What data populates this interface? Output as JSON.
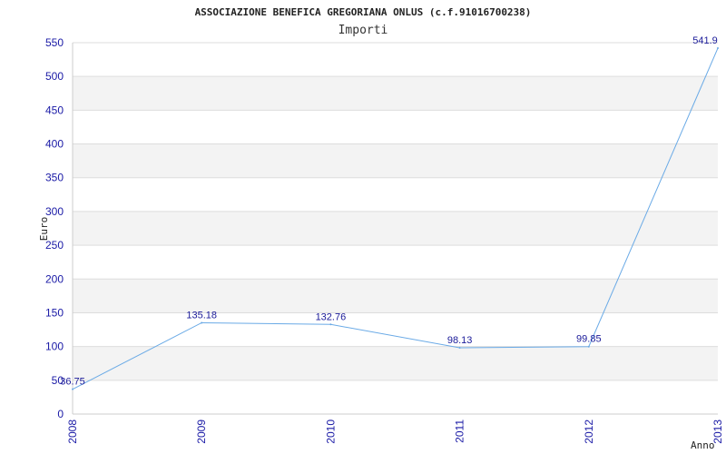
{
  "chart_data": {
    "type": "line",
    "title": "ASSOCIAZIONE BENEFICA GREGORIANA ONLUS (c.f.91016700238)",
    "subtitle": "Importi",
    "xlabel": "Anno",
    "ylabel": "Euro",
    "x": [
      "2008",
      "2009",
      "2010",
      "2011",
      "2012",
      "2013"
    ],
    "series": [
      {
        "values": [
          36.75,
          135.18,
          132.76,
          98.13,
          99.85,
          541.9
        ]
      }
    ],
    "data_labels": [
      "36.75",
      "135.18",
      "132.76",
      "98.13",
      "99.85",
      "541.9"
    ],
    "ylim": [
      0,
      550
    ],
    "yticks": [
      "0",
      "50",
      "100",
      "150",
      "200",
      "250",
      "300",
      "350",
      "400",
      "450",
      "500",
      "550"
    ],
    "grid": "horizontal bands",
    "colors": {
      "line": "#6aaae6",
      "band": "#f3f3f3",
      "gridline": "#dddddd",
      "tick_text": "#1a1aa6"
    }
  }
}
